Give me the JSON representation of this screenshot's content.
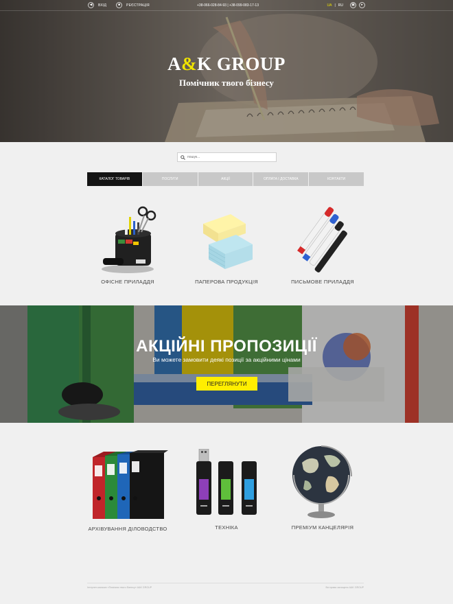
{
  "topbar": {
    "login_label": "ВХІД",
    "register_label": "РЕЄСТРАЦІЯ",
    "phones": "+38-066-028-84-93  |  +38-099-083-17-13",
    "lang_ua": "UA",
    "lang_sep": "|",
    "lang_ru": "RU"
  },
  "hero": {
    "brand_a": "A",
    "brand_amp": "&",
    "brand_rest": "K GROUP",
    "tagline": "Помічник твого бізнесу"
  },
  "search": {
    "placeholder": "пошук..."
  },
  "nav": {
    "tabs": [
      {
        "label": "КАТАЛОГ ТОВАРІВ"
      },
      {
        "label": "ПОСЛУГИ"
      },
      {
        "label": "АКЦІЇ"
      },
      {
        "label": "ОПЛАТА І ДОСТАВКА"
      },
      {
        "label": "КОНТАКТИ"
      }
    ]
  },
  "categories_top": [
    {
      "label": "ОФІСНЕ ПРИЛАДДЯ",
      "icon": "desk-organizer-icon"
    },
    {
      "label": "ПАПЕРОВА ПРОДУКЦІЯ",
      "icon": "sticky-notes-icon"
    },
    {
      "label": "ПИСЬМОВЕ ПРИЛАДДЯ",
      "icon": "markers-icon"
    }
  ],
  "promo": {
    "title": "АКЦІЙНІ ПРОПОЗИЦІЇ",
    "subtitle": "Ви можете замовити деякі позиції за акційними цінами",
    "button_label": "ПЕРЕГЛЯНУТИ"
  },
  "categories_bottom": [
    {
      "label": "АРХІВУВАННЯ ДІЛОВОДСТВО",
      "icon": "binders-icon"
    },
    {
      "label": "ТЕХНІКА",
      "icon": "usb-drives-icon"
    },
    {
      "label": "ПРЕМІУМ КАНЦЕЛЯРІЯ",
      "icon": "globe-icon"
    }
  ],
  "footer": {
    "left": "Інтернет-магазин «Помічник твого бізнесу» A&K GROUP",
    "right": "Всі права захищено A&K GROUP"
  },
  "colors": {
    "accent": "#ffee00",
    "nav_active": "#141414",
    "nav_inactive": "#c8c8c8"
  }
}
